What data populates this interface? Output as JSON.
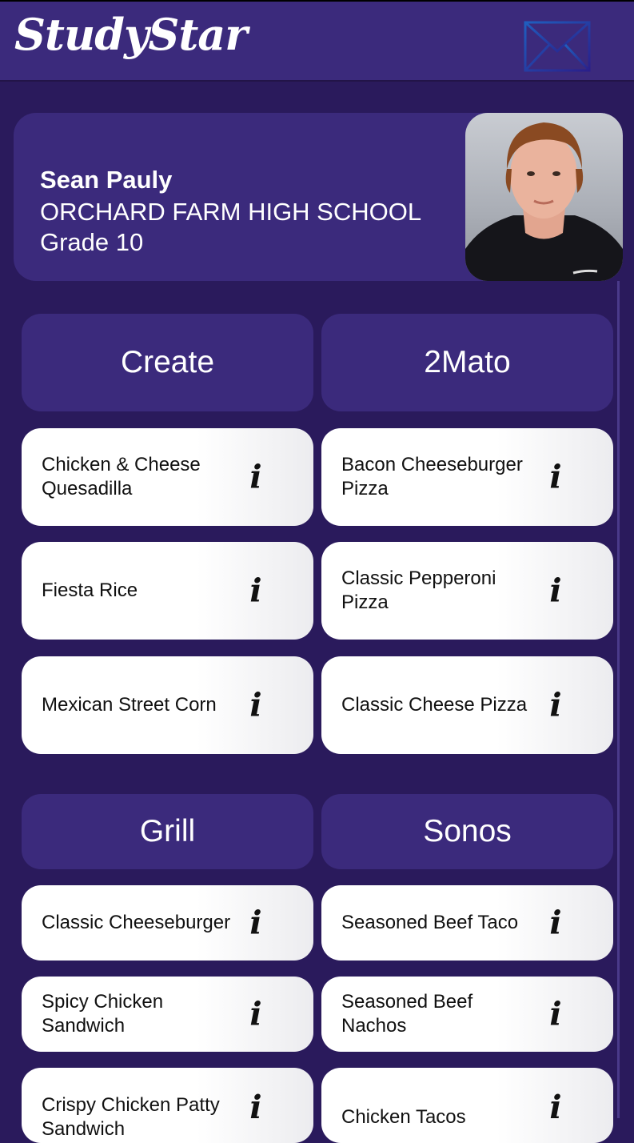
{
  "app": {
    "title": "StudySt​ar",
    "mail_icon": "mail-icon"
  },
  "student": {
    "name": "Sean Pauly",
    "school": "ORCHARD FARM HIGH SCHOOL",
    "grade": "Grade 10"
  },
  "stations": [
    {
      "name": "Create",
      "items": [
        "Chicken & Cheese Quesadilla",
        "Fiesta Rice",
        "Mexican Street Corn"
      ]
    },
    {
      "name": "2Mato",
      "items": [
        "Bacon Cheeseburger Pizza",
        "Classic Pepperoni Pizza",
        "Classic Cheese Pizza"
      ]
    },
    {
      "name": "Grill",
      "items": [
        "Classic Cheeseburger",
        "Spicy Chicken Sandwich",
        "Crispy Chicken Patty Sandwich"
      ]
    },
    {
      "name": "Sonos",
      "items": [
        "Seasoned Beef Taco",
        "Seasoned Beef Nachos",
        "Chicken Tacos"
      ]
    }
  ],
  "info_glyph": "i",
  "colors": {
    "background": "#2a1a5c",
    "card": "#3b2a7c",
    "item": "#ffffff"
  }
}
